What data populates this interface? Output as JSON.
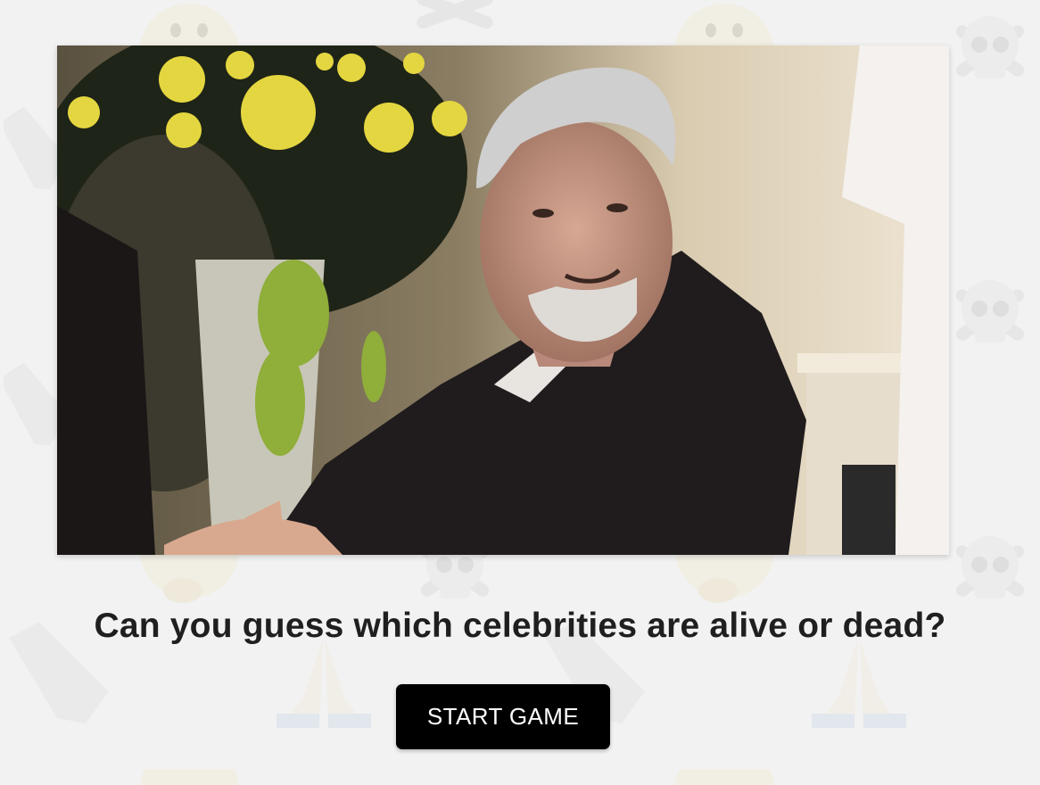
{
  "media": {
    "alt": "Animated clip of a grey-haired bearded man in a dark suit smiling at a wedding"
  },
  "question": "Can you guess which celebrities are alive or dead?",
  "start_button_label": "START GAME",
  "colors": {
    "background": "#f2f2f2",
    "button_bg": "#000000",
    "button_text": "#ffffff",
    "heading_text": "#1f1f1f"
  },
  "background_icons": [
    "skull-crossbones-icon",
    "thinking-face-icon",
    "coffin-icon",
    "praying-hands-icon"
  ]
}
